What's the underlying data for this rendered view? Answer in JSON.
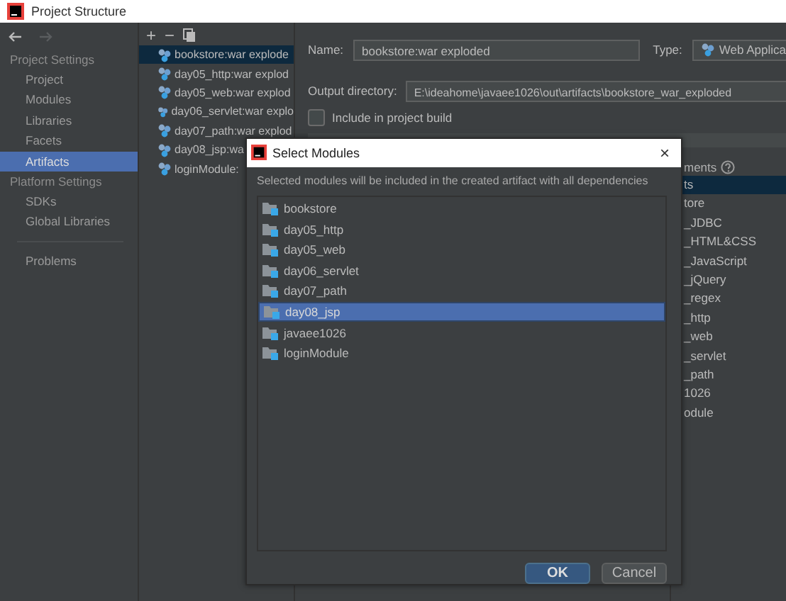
{
  "window": {
    "title": "Project Structure"
  },
  "sidebar": {
    "sections": [
      {
        "heading": "Project Settings",
        "items": [
          {
            "label": "Project",
            "selected": false
          },
          {
            "label": "Modules",
            "selected": false
          },
          {
            "label": "Libraries",
            "selected": false
          },
          {
            "label": "Facets",
            "selected": false
          },
          {
            "label": "Artifacts",
            "selected": true
          }
        ]
      },
      {
        "heading": "Platform Settings",
        "items": [
          {
            "label": "SDKs",
            "selected": false
          },
          {
            "label": "Global Libraries",
            "selected": false
          }
        ]
      }
    ],
    "bottom_items": [
      {
        "label": "Problems",
        "selected": false
      }
    ]
  },
  "artifacts": {
    "toolbar": [
      "+",
      "−"
    ],
    "items": [
      {
        "label": "bookstore:war explode",
        "selected": true
      },
      {
        "label": "day05_http:war explod",
        "selected": false
      },
      {
        "label": "day05_web:war explod",
        "selected": false
      },
      {
        "label": "day06_servlet:war explo",
        "selected": false
      },
      {
        "label": "day07_path:war explod",
        "selected": false
      },
      {
        "label": "day08_jsp:wa",
        "selected": false
      },
      {
        "label": "loginModule:",
        "selected": false
      }
    ]
  },
  "editor": {
    "name_label": "Name:",
    "name_value": "bookstore:war exploded",
    "type_label": "Type:",
    "type_value": "Web Applica",
    "output_label": "Output directory:",
    "output_value": "E:\\ideahome\\javaee1026\\out\\artifacts\\bookstore_war_exploded",
    "include_build": {
      "label": "Include in project build",
      "checked": false
    },
    "available_heading": "ments",
    "available": [
      {
        "label": "ts",
        "selected": true
      },
      {
        "label": "tore",
        "selected": false
      },
      {
        "label": "_JDBC",
        "selected": false
      },
      {
        "label": "_HTML&CSS",
        "selected": false
      },
      {
        "label": "_JavaScript",
        "selected": false
      },
      {
        "label": "_jQuery",
        "selected": false
      },
      {
        "label": "_regex",
        "selected": false
      },
      {
        "label": "_http",
        "selected": false
      },
      {
        "label": "_web",
        "selected": false
      },
      {
        "label": "_servlet",
        "selected": false
      },
      {
        "label": "_path",
        "selected": false
      },
      {
        "label": "1026",
        "selected": false
      },
      {
        "label": "odule",
        "selected": false
      }
    ]
  },
  "dialog": {
    "title": "Select Modules",
    "close": "×",
    "description": "Selected modules will be included in the created artifact with all dependencies",
    "modules": [
      {
        "label": "bookstore",
        "selected": false
      },
      {
        "label": "day05_http",
        "selected": false
      },
      {
        "label": "day05_web",
        "selected": false
      },
      {
        "label": "day06_servlet",
        "selected": false
      },
      {
        "label": "day07_path",
        "selected": false
      },
      {
        "label": "day08_jsp",
        "selected": true
      },
      {
        "label": "javaee1026",
        "selected": false
      },
      {
        "label": "loginModule",
        "selected": false
      }
    ],
    "buttons": [
      {
        "label": "OK",
        "kind": "primary"
      },
      {
        "label": "Cancel",
        "kind": "secondary"
      }
    ]
  }
}
